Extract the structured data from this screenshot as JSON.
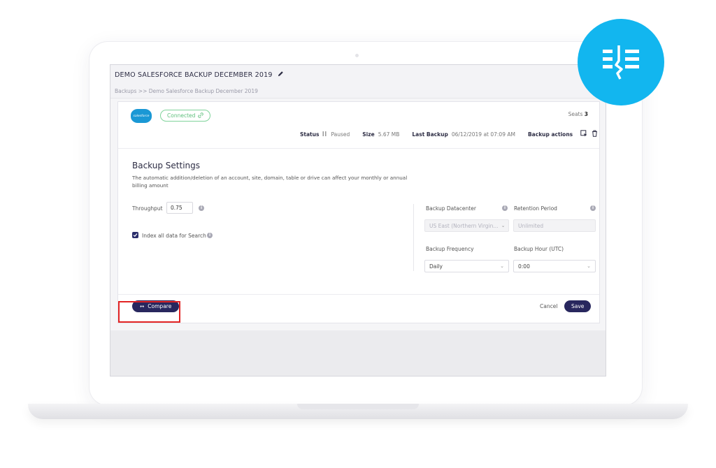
{
  "header": {
    "title": "DEMO SALESFORCE BACKUP DECEMBER 2019",
    "breadcrumb": "Backups >> Demo Salesforce Backup December 2019"
  },
  "connection": {
    "logo_text": "salesforce",
    "badge": "Connected",
    "seats_label": "Seats",
    "seats_value": "3"
  },
  "status_bar": {
    "status_label": "Status",
    "status_icon": "pause-icon",
    "status_value": "Paused",
    "size_label": "Size",
    "size_value": "5.67 MB",
    "last_backup_label": "Last Backup",
    "last_backup_value": "06/12/2019 at 07:09 AM",
    "actions_label": "Backup actions"
  },
  "settings": {
    "title": "Backup Settings",
    "description": "The automatic addition/deletion of an account, site, domain, table or drive can affect your monthly or annual billing amount",
    "throughput_label": "Throughput",
    "throughput_value": "0.75",
    "index_label": "Index all data for Search",
    "index_checked": true,
    "datacenter_label": "Backup Datacenter",
    "datacenter_value": "US East (Northern Virgin...",
    "retention_label": "Retention Period",
    "retention_value": "Unlimited",
    "frequency_label": "Backup Frequency",
    "frequency_value": "Daily",
    "hour_label": "Backup Hour (UTC)",
    "hour_value": "0:00"
  },
  "footer": {
    "compare_label": "Compare",
    "cancel_label": "Cancel",
    "save_label": "Save"
  },
  "colors": {
    "primary": "#28275e",
    "connected": "#5cbf7b",
    "brand_badge": "#12b6ef",
    "salesforce": "#1a98d5",
    "highlight": "#e22424"
  }
}
